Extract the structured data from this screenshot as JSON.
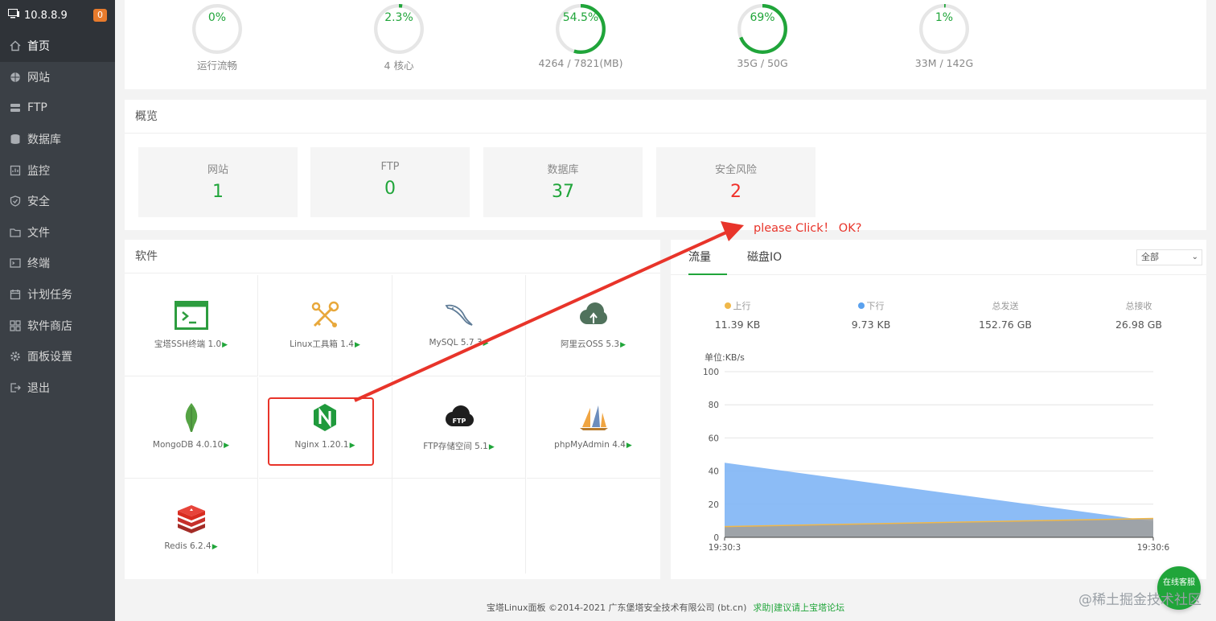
{
  "sidebar": {
    "ip": "10.8.8.9",
    "badge": "0",
    "items": [
      {
        "label": "首页",
        "icon": "home-icon"
      },
      {
        "label": "网站",
        "icon": "globe-icon"
      },
      {
        "label": "FTP",
        "icon": "ftp-icon"
      },
      {
        "label": "数据库",
        "icon": "database-icon"
      },
      {
        "label": "监控",
        "icon": "monitor-icon"
      },
      {
        "label": "安全",
        "icon": "shield-icon"
      },
      {
        "label": "文件",
        "icon": "folder-icon"
      },
      {
        "label": "终端",
        "icon": "terminal-icon"
      },
      {
        "label": "计划任务",
        "icon": "calendar-icon"
      },
      {
        "label": "软件商店",
        "icon": "grid-icon"
      },
      {
        "label": "面板设置",
        "icon": "gear-icon"
      },
      {
        "label": "退出",
        "icon": "logout-icon"
      }
    ]
  },
  "status": [
    {
      "value": "0%",
      "label": "运行流畅",
      "percent": 0
    },
    {
      "value": "2.3%",
      "label": "4 核心",
      "percent": 2.3
    },
    {
      "value": "54.5%",
      "label": "4264 / 7821(MB)",
      "percent": 54.5
    },
    {
      "value": "69%",
      "label": "35G / 50G",
      "percent": 69
    },
    {
      "value": "1%",
      "label": "33M / 142G",
      "percent": 1
    }
  ],
  "overview": {
    "title": "概览",
    "cards": [
      {
        "label": "网站",
        "value": "1"
      },
      {
        "label": "FTP",
        "value": "0"
      },
      {
        "label": "数据库",
        "value": "37"
      },
      {
        "label": "安全风险",
        "value": "2"
      }
    ]
  },
  "software": {
    "title": "软件",
    "items": [
      {
        "name": "宝塔SSH终端 1.0",
        "icon": "ssh-terminal-icon"
      },
      {
        "name": "Linux工具箱 1.4",
        "icon": "toolbox-icon"
      },
      {
        "name": "MySQL 5.7.3",
        "icon": "mysql-icon"
      },
      {
        "name": "阿里云OSS 5.3",
        "icon": "aliyun-oss-icon"
      },
      {
        "name": "MongoDB 4.0.10",
        "icon": "mongodb-icon"
      },
      {
        "name": "Nginx 1.20.1",
        "icon": "nginx-icon"
      },
      {
        "name": "FTP存储空间 5.1",
        "icon": "ftp-cloud-icon"
      },
      {
        "name": "phpMyAdmin 4.4",
        "icon": "phpmyadmin-icon"
      },
      {
        "name": "Redis 6.2.4",
        "icon": "redis-icon"
      }
    ],
    "arrow": "▶"
  },
  "traffic": {
    "tabs": [
      "流量",
      "磁盘IO"
    ],
    "select": "全部",
    "stats": [
      {
        "label": "上行",
        "value": "11.39 KB",
        "color": "#f0b84a"
      },
      {
        "label": "下行",
        "value": "9.73 KB",
        "color": "#5aa1ee"
      },
      {
        "label": "总发送",
        "value": "152.76 GB"
      },
      {
        "label": "总接收",
        "value": "26.98 GB"
      }
    ]
  },
  "chart_data": {
    "type": "area",
    "ylabel": "单位:KB/s",
    "ylim": [
      0,
      100
    ],
    "yticks": [
      0,
      20,
      40,
      60,
      80,
      100
    ],
    "x": [
      "19:30:3",
      "19:30:6"
    ],
    "series": [
      {
        "name": "上行",
        "values": [
          6.5,
          11.4
        ],
        "color": "#f0b84a"
      },
      {
        "name": "下行",
        "values": [
          45,
          9.7
        ],
        "color": "#5aa1ee"
      }
    ],
    "grid": true
  },
  "annotation": "please Click！ OK?",
  "footer": {
    "text": "宝塔Linux面板 ©2014-2021 广东堡塔安全技术有限公司 (bt.cn)",
    "link": "求助|建议请上宝塔论坛"
  },
  "chat_label": "在线客服",
  "watermark": "@稀土掘金技术社区",
  "colors": {
    "accent": "#20a53a",
    "danger": "#f0302a",
    "sidebar": "#3b4046"
  }
}
